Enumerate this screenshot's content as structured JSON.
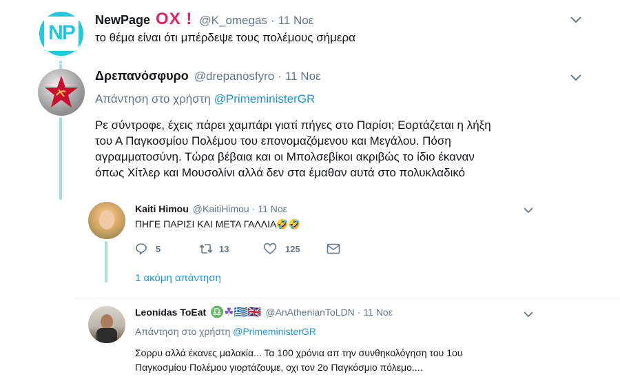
{
  "tweet1": {
    "name": "NewPage",
    "badges": "ΟΧ !",
    "handle": "@K_omegas",
    "dot": "·",
    "date": "11 Νοε",
    "text": "το θέμα είναι ότι μπέρδεψε τους πολέμους σήμερα",
    "avatar_text": "NP"
  },
  "tweet2": {
    "name": "Δρεπανόσφυρο",
    "handle": "@drepanosfyro",
    "dot": "·",
    "date": "11 Νοε",
    "reply_prefix": "Απάντηση στο χρήστη",
    "reply_to": "@PrimeministerGR",
    "lines": [
      "Ρε σύντροφε, έχεις πάρει χαμπάρι γιατί πήγες στο Παρίσι; Εορτάζεται η λήξη",
      "του Α Παγκοσμίου Πολέμου του επονομαζόμενου και Μεγάλου. Πόση",
      "αγραμματοσύνη. Τώρα βέβαια και οι Μπολσεβίκοι ακριβώς το ίδιο έκαναν",
      "όπως Χίτλερ και Μουσολίνι αλλά δεν στα έμαθαν αυτά στο πολυκλαδικό"
    ]
  },
  "tweet3": {
    "name": "Kaiti Himou",
    "handle": "@KaitiHimou",
    "dot": "·",
    "date": "11 Νοε",
    "text": "ΠΗΓΕ ΠΑΡΙΣΙ ΚΑΙ ΜΕΤΑ ΓΑΛΛΙΑ🤣🤣",
    "replies": "5",
    "retweets": "13",
    "likes": "125"
  },
  "more_replies": "1 ακόμη απάντηση",
  "tweet4": {
    "name": "Leonidas ToEat",
    "badges": "♎☘🇬🇷🇬🇧",
    "handle": "@AnAthenianToLDN",
    "dot": "·",
    "date": "11 Νοε",
    "reply_prefix": "Απάντηση στο χρήστη",
    "reply_to": "@PrimeministerGR",
    "lines": [
      "Σορρυ αλλά έκανες μαλακία... Τα 100 χρόνια απ την συνθηκολόγηση του 1ου",
      "Παγκοσμίου Πολέμου γιορτάζουμε, οχι τον 2ο Παγκόσμιο πόλεμο...."
    ]
  },
  "colors": {
    "link": "#1b95e0",
    "thread": "#a8dedc",
    "muted": "#657786",
    "badge_red": "#e0245e"
  },
  "icons": [
    "reply-icon",
    "retweet-icon",
    "like-icon",
    "dm-icon",
    "chevron-down-icon"
  ]
}
